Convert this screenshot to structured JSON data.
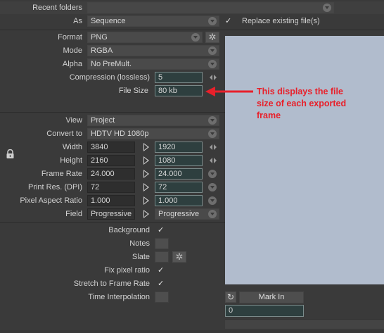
{
  "recent_folders": {
    "label": "Recent folders",
    "value": ""
  },
  "as": {
    "label": "As",
    "value": "Sequence"
  },
  "replace_existing": {
    "label": "Replace existing file(s)",
    "checked": true
  },
  "format": {
    "label": "Format",
    "value": "PNG"
  },
  "mode": {
    "label": "Mode",
    "value": "RGBA"
  },
  "alpha": {
    "label": "Alpha",
    "value": "No PreMult."
  },
  "compression": {
    "label": "Compression (lossless)",
    "value": "5"
  },
  "file_size": {
    "label": "File Size",
    "value": "80 kb"
  },
  "annotation": {
    "line1": "This displays the file",
    "line2": "size of each exported",
    "line3": "frame",
    "color": "#e8202a"
  },
  "view": {
    "label": "View",
    "value": "Project"
  },
  "convert_to": {
    "label": "Convert to",
    "value": "HDTV  HD 1080p"
  },
  "width": {
    "label": "Width",
    "source": "3840",
    "target": "1920"
  },
  "height": {
    "label": "Height",
    "source": "2160",
    "target": "1080"
  },
  "frame_rate": {
    "label": "Frame Rate",
    "source": "24.000",
    "target": "24.000"
  },
  "print_res": {
    "label": "Print Res. (DPI)",
    "source": "72",
    "target": "72"
  },
  "pixel_aspect": {
    "label": "Pixel Aspect Ratio",
    "source": "1.000",
    "target": "1.000"
  },
  "field": {
    "label": "Field",
    "source": "Progressive",
    "target": "Progressive"
  },
  "background": {
    "label": "Background",
    "checked": true
  },
  "notes": {
    "label": "Notes",
    "checked": false
  },
  "slate": {
    "label": "Slate",
    "checked": false
  },
  "fix_pixel_ratio": {
    "label": "Fix pixel ratio",
    "checked": true
  },
  "stretch_to_frame_rate": {
    "label": "Stretch to Frame Rate",
    "checked": true
  },
  "time_interpolation": {
    "label": "Time Interpolation",
    "checked": false
  },
  "preview": {
    "bg_color": "#b1bccd",
    "mark_in_label": "Mark In",
    "frame_value": "0"
  },
  "glyphs": {
    "check": "✓",
    "gear": "✲",
    "refresh": "↻",
    "lock": "🔒"
  }
}
